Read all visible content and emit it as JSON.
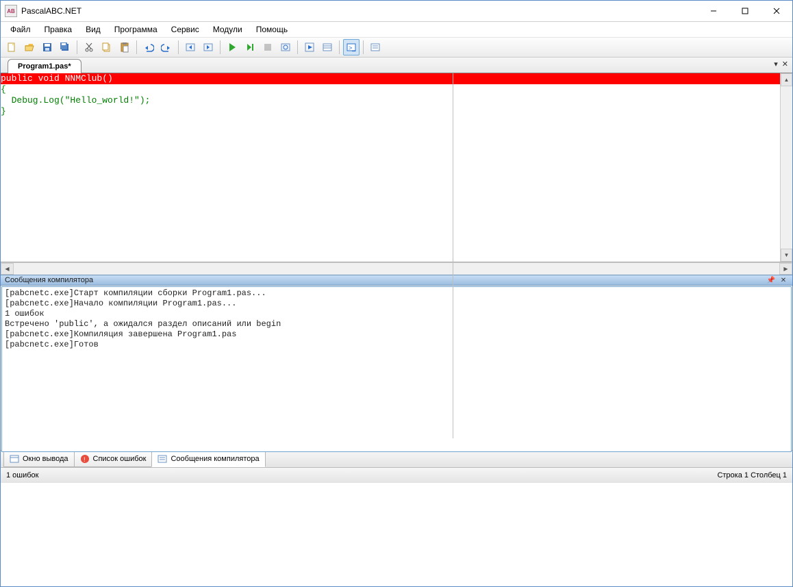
{
  "title": "PascalABC.NET",
  "menu": [
    "Файл",
    "Правка",
    "Вид",
    "Программа",
    "Сервис",
    "Модули",
    "Помощь"
  ],
  "toolbar_icons": [
    "new-file",
    "open-file",
    "save",
    "save-all",
    "cut",
    "copy",
    "paste",
    "undo",
    "redo",
    "nav-back",
    "nav-forward",
    "run",
    "step",
    "stop",
    "breakpoint",
    "watch",
    "locals",
    "output-window",
    "errors-window"
  ],
  "tab": "Program1.pas*",
  "code": {
    "err_line": "public void NNMClub()",
    "l2": "{",
    "l3": "  Debug.Log(\"Hello_world!\");",
    "l4": "}"
  },
  "compiler_title": "Сообщения компилятора",
  "compiler_msgs": [
    "[pabcnetc.exe]Старт компиляции сборки Program1.pas...",
    "[pabcnetc.exe]Начало компиляции Program1.pas...",
    "1 ошибок",
    "Встречено 'public', а ожидался раздел описаний или begin",
    "[pabcnetc.exe]Компиляция завершена Program1.pas",
    "[pabcnetc.exe]Готов"
  ],
  "bottom_tabs": {
    "output": "Окно вывода",
    "errors": "Список ошибок",
    "compiler": "Сообщения компилятора"
  },
  "status": {
    "left": "1 ошибок",
    "line": "Строка 1",
    "col": "Столбец 1"
  }
}
